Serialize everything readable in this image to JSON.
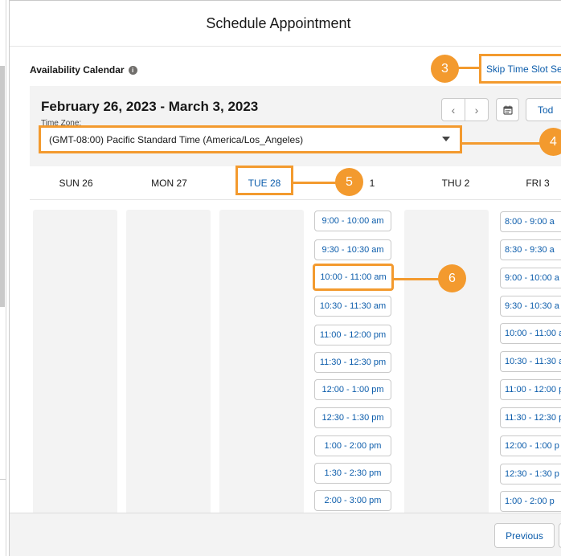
{
  "modal": {
    "title": "Schedule Appointment"
  },
  "availability": {
    "label": "Availability Calendar",
    "info_icon": "info-icon"
  },
  "skip_link": {
    "label": "Skip Time Slot Se"
  },
  "toolbar": {
    "date_range": "February 26, 2023 - March 3, 2023",
    "timezone_label": "Time Zone:",
    "timezone_value": "(GMT-08:00) Pacific Standard Time (America/Los_Angeles)",
    "prev_icon": "chevron-left-icon",
    "next_icon": "chevron-right-icon",
    "calendar_icon": "calendar-icon",
    "today_label": "Tod"
  },
  "days": [
    {
      "label": "SUN 26",
      "selected": false
    },
    {
      "label": "MON 27",
      "selected": false
    },
    {
      "label": "TUE 28",
      "selected": true
    },
    {
      "label": "1",
      "selected": false
    },
    {
      "label": "THU 2",
      "selected": false
    },
    {
      "label": "FRI 3",
      "selected": false
    }
  ],
  "wed_slots": [
    "9:00 - 10:00 am",
    "9:30 - 10:30 am",
    "10:00 - 11:00 am",
    "10:30 - 11:30 am",
    "11:00 - 12:00 pm",
    "11:30 - 12:30 pm",
    "12:00 - 1:00 pm",
    "12:30 - 1:30 pm",
    "1:00 - 2:00 pm",
    "1:30 - 2:30 pm",
    "2:00 - 3:00 pm"
  ],
  "fri_slots": [
    "8:00 - 9:00 a",
    "8:30 - 9:30 a",
    "9:00 - 10:00 a",
    "9:30 - 10:30 a",
    "10:00 - 11:00 a",
    "10:30 - 11:30 a",
    "11:00 - 12:00 p",
    "11:30 - 12:30 p",
    "12:00 - 1:00 p",
    "12:30 - 1:30 p",
    "1:00 - 2:00 p"
  ],
  "callouts": [
    "3",
    "4",
    "5",
    "6"
  ],
  "footer": {
    "previous_label": "Previous"
  },
  "colors": {
    "accent": "#f39a2e",
    "link": "#0b5cab",
    "panel": "#f3f3f3"
  }
}
